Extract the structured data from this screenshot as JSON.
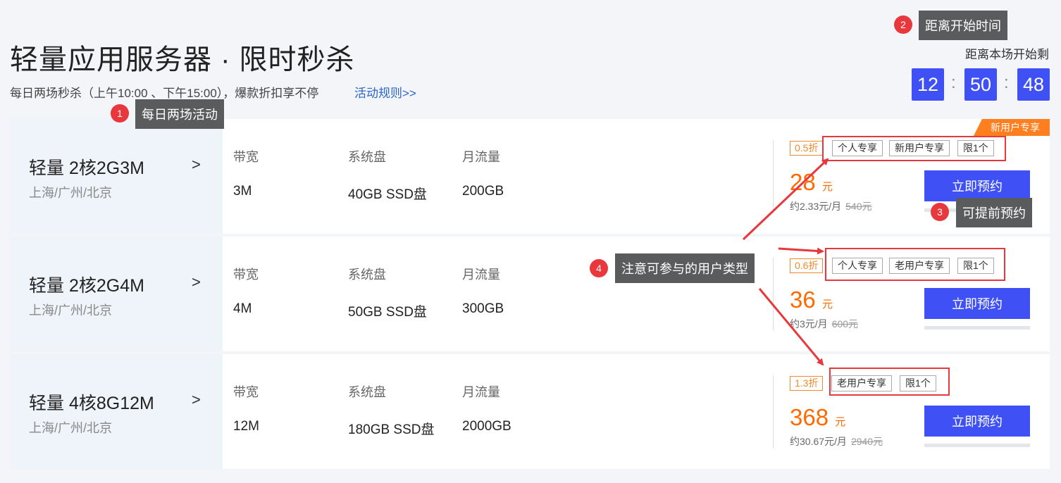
{
  "header": {
    "title": "轻量应用服务器 · 限时秒杀",
    "subtitle": "每日两场秒杀（上午10:00 、下午15:00），爆款折扣享不停",
    "rules_link": "活动规则>>"
  },
  "countdown": {
    "label": "距离本场开始剩",
    "hours": "12",
    "minutes": "50",
    "seconds": "48",
    "separator": ":"
  },
  "spec_labels": {
    "bandwidth": "带宽",
    "disk": "系统盘",
    "traffic": "月流量"
  },
  "products": [
    {
      "name": "轻量 2核2G3M",
      "region": "上海/广州/北京",
      "bandwidth": "3M",
      "disk": "40GB SSD盘",
      "traffic": "200GB",
      "discount": "0.5折",
      "tags": [
        "个人专享",
        "新用户专享",
        "限1个"
      ],
      "price": "28",
      "price_unit": "元",
      "monthly": "约2.33元/月",
      "original": "540元",
      "button": "立即预约",
      "corner_badge": "新用户专享"
    },
    {
      "name": "轻量 2核2G4M",
      "region": "上海/广州/北京",
      "bandwidth": "4M",
      "disk": "50GB SSD盘",
      "traffic": "300GB",
      "discount": "0.6折",
      "tags": [
        "个人专享",
        "老用户专享",
        "限1个"
      ],
      "price": "36",
      "price_unit": "元",
      "monthly": "约3元/月",
      "original": "600元",
      "button": "立即预约"
    },
    {
      "name": "轻量 4核8G12M",
      "region": "上海/广州/北京",
      "bandwidth": "12M",
      "disk": "180GB SSD盘",
      "traffic": "2000GB",
      "discount": "1.3折",
      "tags": [
        "老用户专享",
        "限1个"
      ],
      "price": "368",
      "price_unit": "元",
      "monthly": "约30.67元/月",
      "original": "2940元",
      "button": "立即预约"
    }
  ],
  "chev": ">",
  "annotations": [
    {
      "num": "1",
      "text": "每日两场活动"
    },
    {
      "num": "2",
      "text": "距离开始时间"
    },
    {
      "num": "3",
      "text": "可提前预约"
    },
    {
      "num": "4",
      "text": "注意可参与的用户类型"
    }
  ],
  "colors": {
    "accent": "#3f51f5",
    "price": "#ff6a00",
    "annotation_red": "#e8383d"
  }
}
